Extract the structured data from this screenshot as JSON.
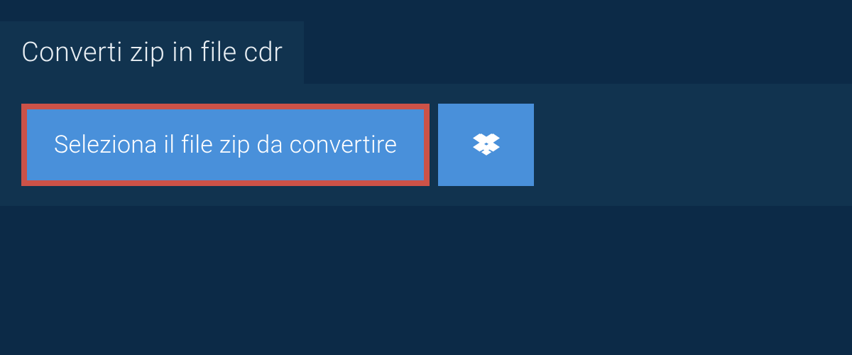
{
  "header": {
    "title": "Converti zip in file cdr"
  },
  "actions": {
    "select_file_label": "Seleziona il file zip da convertire",
    "dropbox_icon": "dropbox-icon"
  },
  "colors": {
    "background": "#0c2a47",
    "panel": "#11334f",
    "button": "#4990da",
    "highlight_border": "#cc5248",
    "text_light": "#e8eef3"
  }
}
